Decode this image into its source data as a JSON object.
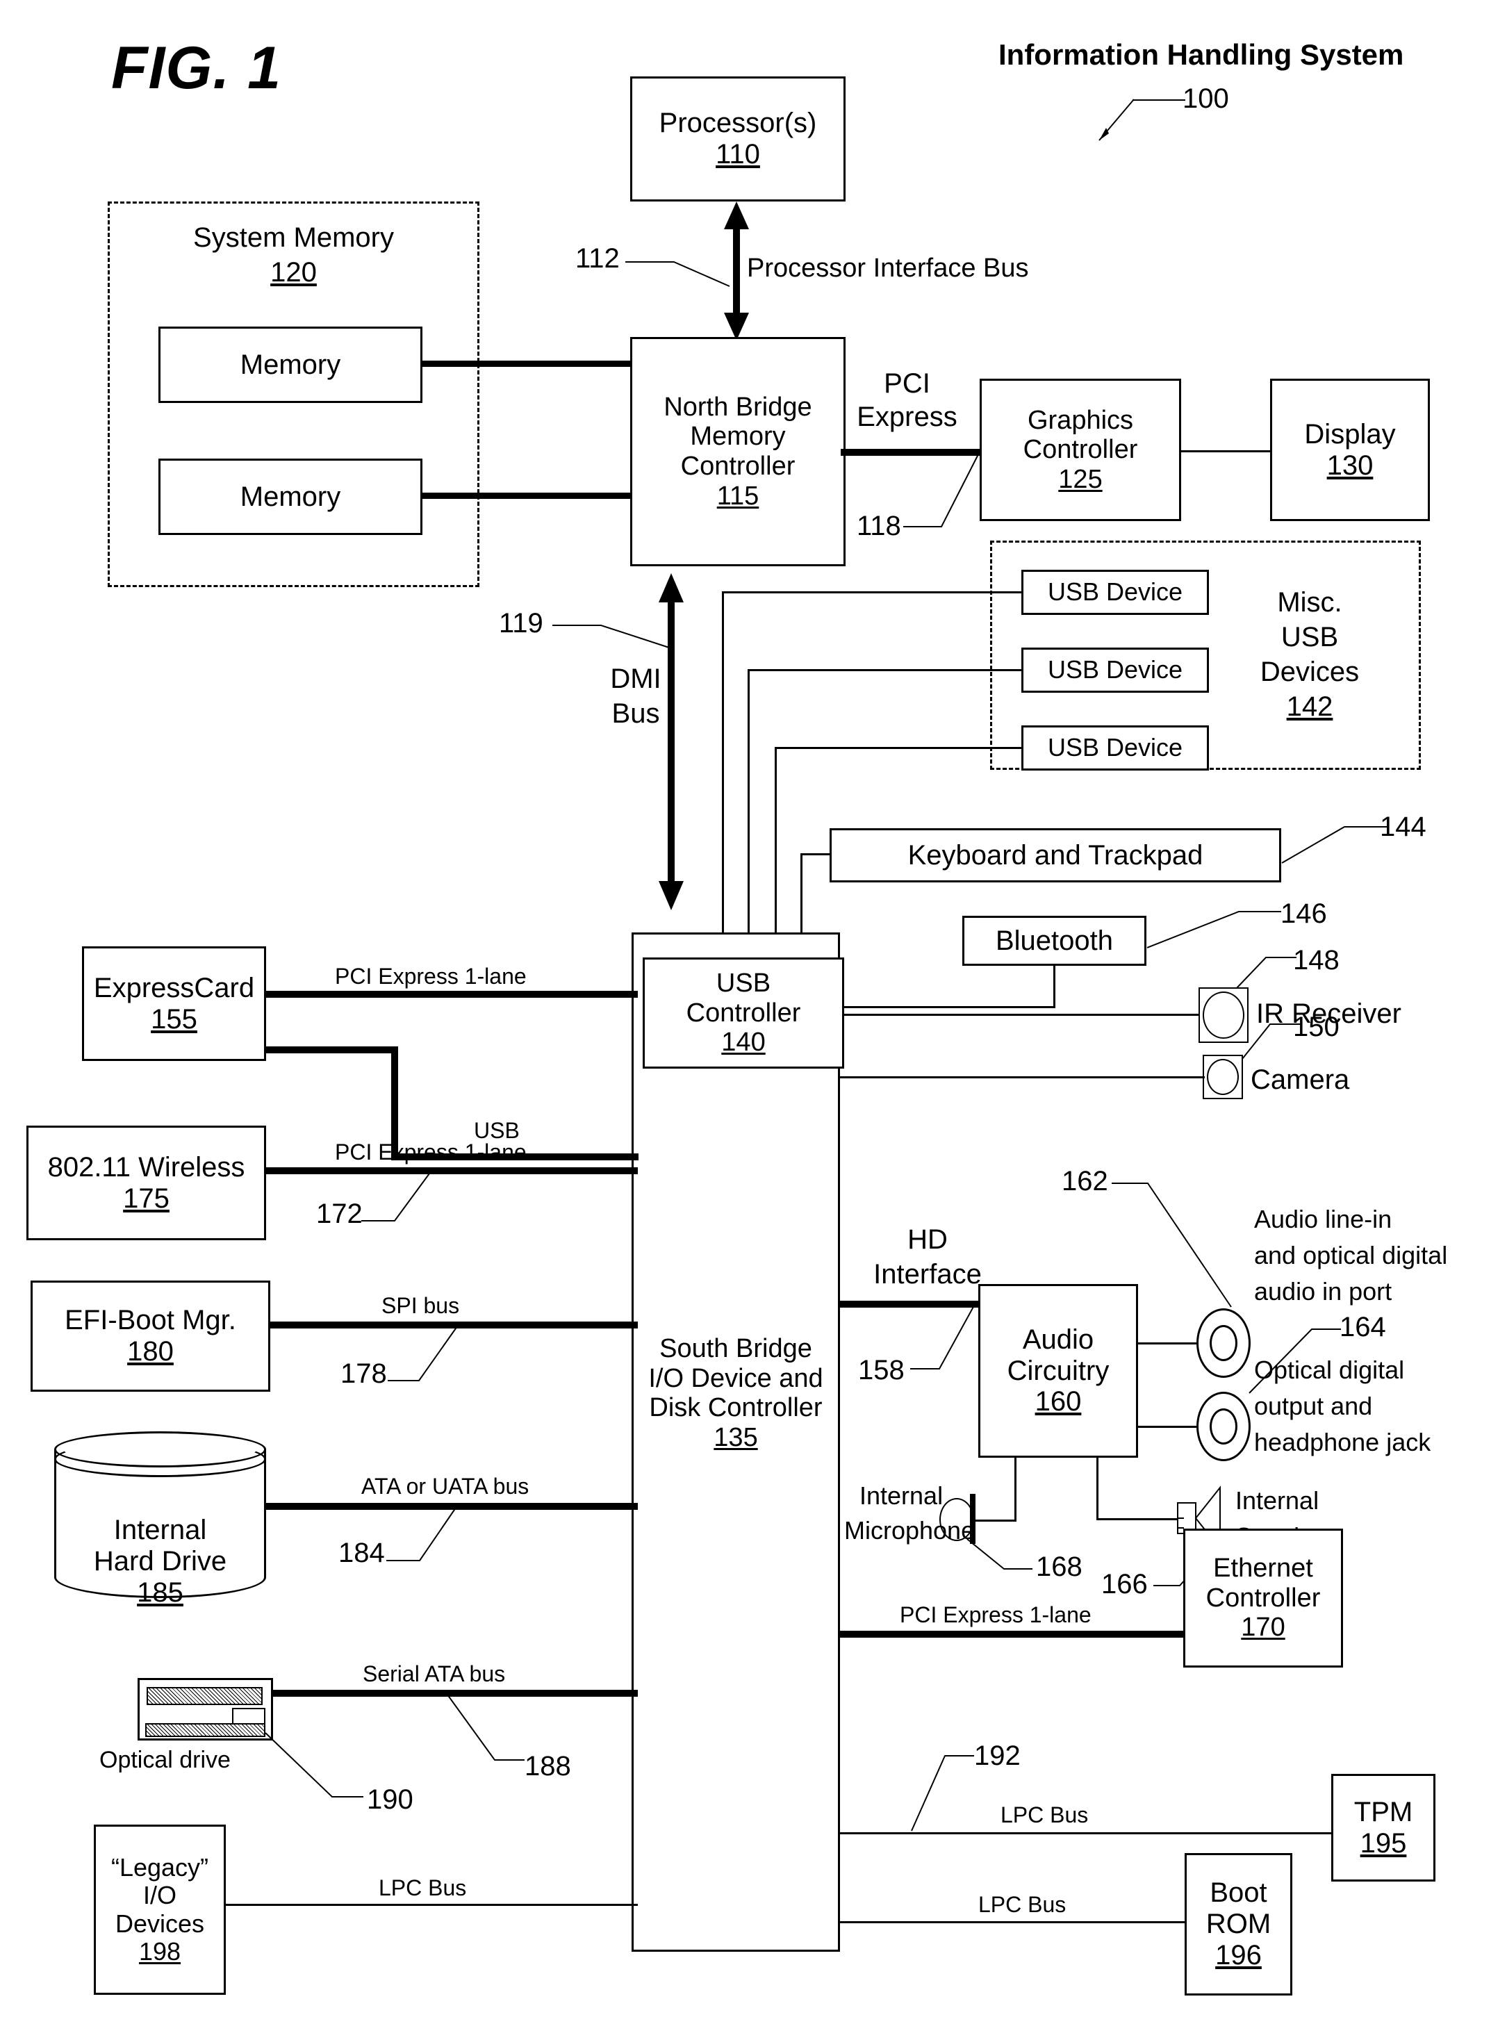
{
  "figure": {
    "label": "FIG. 1",
    "system_title": "Information Handling System",
    "system_ref": "100"
  },
  "blocks": {
    "processor": {
      "title": "Processor(s)",
      "ref": "110"
    },
    "system_memory": {
      "title": "System Memory",
      "ref": "120"
    },
    "memory_1": {
      "title": "Memory"
    },
    "memory_2": {
      "title": "Memory"
    },
    "north_bridge": {
      "line1": "North Bridge",
      "line2": "Memory",
      "line3": "Controller",
      "ref": "115"
    },
    "graphics": {
      "line1": "Graphics",
      "line2": "Controller",
      "ref": "125"
    },
    "display": {
      "title": "Display",
      "ref": "130"
    },
    "misc_usb": {
      "line1": "Misc.",
      "line2": "USB",
      "line3": "Devices",
      "ref": "142"
    },
    "usb_device_1": {
      "title": "USB Device"
    },
    "usb_device_2": {
      "title": "USB Device"
    },
    "usb_device_3": {
      "title": "USB Device"
    },
    "keyboard": {
      "title": "Keyboard and Trackpad",
      "ref": "144"
    },
    "bluetooth": {
      "title": "Bluetooth",
      "ref": "146"
    },
    "ir_receiver": {
      "title": "IR Receiver",
      "ref": "148"
    },
    "camera": {
      "title": "Camera",
      "ref": "150"
    },
    "usb_controller": {
      "line1": "USB",
      "line2": "Controller",
      "ref": "140"
    },
    "south_bridge": {
      "line1": "South Bridge",
      "line2": "I/O Device and",
      "line3": "Disk Controller",
      "ref": "135"
    },
    "expresscard": {
      "title": "ExpressCard",
      "ref": "155"
    },
    "wireless": {
      "title": "802.11 Wireless",
      "ref": "175"
    },
    "efi_boot": {
      "title": "EFI-Boot Mgr.",
      "ref": "180"
    },
    "hard_drive": {
      "line1": "Internal",
      "line2": "Hard Drive",
      "ref": "185"
    },
    "optical_drive": {
      "caption": "Optical drive",
      "ref": "190"
    },
    "legacy_io": {
      "line1": "“Legacy”",
      "line2": "I/O",
      "line3": "Devices",
      "ref": "198"
    },
    "audio_circuitry": {
      "line1": "Audio",
      "line2": "Circuitry",
      "ref": "160"
    },
    "audio_line_in": {
      "line1": "Audio line-in",
      "line2": "and optical digital",
      "line3": "audio in port",
      "ref": "162"
    },
    "optical_out": {
      "line1": "Optical digital",
      "line2": "output and",
      "line3": "headphone jack",
      "ref": "164"
    },
    "internal_mic": {
      "line1": "Internal",
      "line2": "Microphone",
      "ref": "168"
    },
    "internal_speakers": {
      "line1": "Internal",
      "line2": "Speakers",
      "ref": "166"
    },
    "ethernet": {
      "line1": "Ethernet",
      "line2": "Controller",
      "ref": "170"
    },
    "tpm": {
      "title": "TPM",
      "ref": "195"
    },
    "boot_rom": {
      "line1": "Boot",
      "line2": "ROM",
      "ref": "196"
    }
  },
  "buses": {
    "processor_interface": {
      "label": "Processor Interface Bus",
      "ref": "112"
    },
    "pci_express_gfx": {
      "line1": "PCI",
      "line2": "Express",
      "ref": "118"
    },
    "dmi": {
      "line1": "DMI",
      "line2": "Bus",
      "ref": "119"
    },
    "pcie_expresscard": {
      "label": "PCI Express 1-lane"
    },
    "usb_expresscard": {
      "label": "USB"
    },
    "pcie_wireless": {
      "label": "PCI Express 1-lane",
      "ref": "172"
    },
    "spi": {
      "label": "SPI bus",
      "ref": "178"
    },
    "ata": {
      "label": "ATA or UATA bus",
      "ref": "184"
    },
    "sata": {
      "label": "Serial ATA bus",
      "ref": "188"
    },
    "lpc_legacy": {
      "label": "LPC Bus"
    },
    "hd_interface": {
      "line1": "HD",
      "line2": "Interface",
      "ref": "158"
    },
    "pcie_ethernet": {
      "label": "PCI Express 1-lane"
    },
    "lpc_tpm": {
      "label": "LPC Bus",
      "ref": "192"
    },
    "lpc_bootrom": {
      "label": "LPC Bus"
    }
  }
}
